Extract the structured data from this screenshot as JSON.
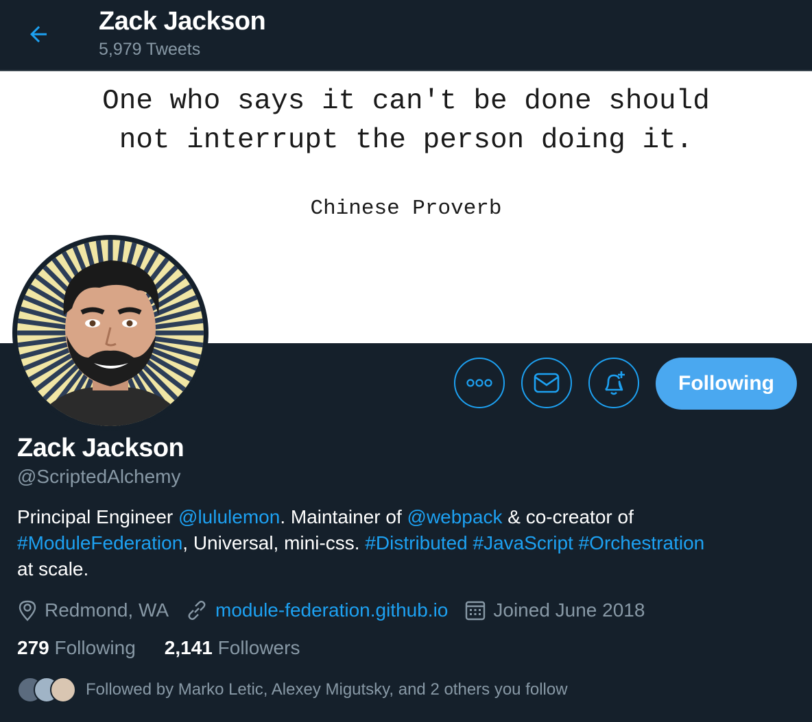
{
  "header": {
    "name": "Zack Jackson",
    "tweet_count": "5,979 Tweets"
  },
  "banner": {
    "quote": "One who says it can't be done should\nnot interrupt the person doing it.",
    "attribution": "Chinese Proverb"
  },
  "actions": {
    "more_icon": "more-icon",
    "message_icon": "mail-icon",
    "notify_icon": "bell-plus-icon",
    "follow_label": "Following"
  },
  "profile": {
    "name": "Zack Jackson",
    "handle": "@ScriptedAlchemy",
    "bio": [
      {
        "text": "Principal Engineer ",
        "link": false
      },
      {
        "text": "@lululemon",
        "link": true
      },
      {
        "text": ". Maintainer of ",
        "link": false
      },
      {
        "text": "@webpack",
        "link": true
      },
      {
        "text": " & co-creator of ",
        "link": false
      },
      {
        "text": "#ModuleFederation",
        "link": true
      },
      {
        "text": ", Universal, mini-css. ",
        "link": false
      },
      {
        "text": "#Distributed",
        "link": true
      },
      {
        "text": " ",
        "link": false
      },
      {
        "text": "#JavaScript",
        "link": true
      },
      {
        "text": " ",
        "link": false
      },
      {
        "text": "#Orchestration",
        "link": true
      },
      {
        "text": " at scale.",
        "link": false
      }
    ],
    "location": "Redmond, WA",
    "website": "module-federation.github.io",
    "joined": "Joined June 2018"
  },
  "stats": {
    "following_count": "279",
    "following_label": "Following",
    "followers_count": "2,141",
    "followers_label": "Followers"
  },
  "followed_by": "Followed by Marko Letic, Alexey Migutsky, and 2 others you follow",
  "colors": {
    "background": "#15202b",
    "accent": "#1da1f2",
    "secondary_text": "#8899a6"
  }
}
